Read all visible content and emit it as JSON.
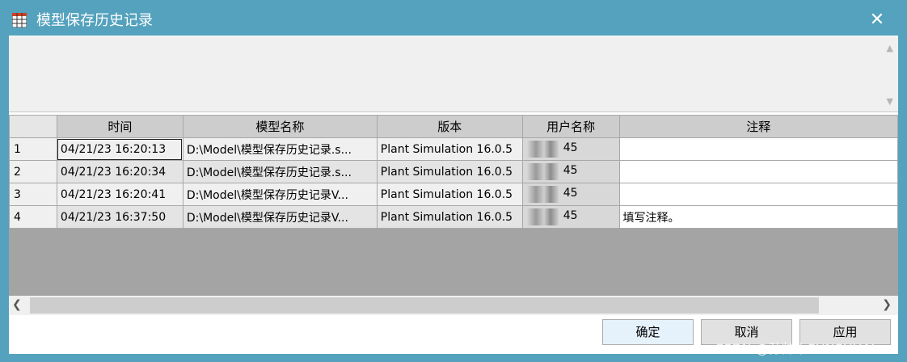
{
  "window": {
    "title": "模型保存历史记录",
    "close_glyph": "✕"
  },
  "grid": {
    "columns": [
      "时间",
      "模型名称",
      "版本",
      "用户名称",
      "注释"
    ],
    "rows": [
      {
        "index": "1",
        "time": "04/21/23 16:20:13",
        "model": "D:\\Model\\模型保存历史记录.s...",
        "version": "Plant Simulation 16.0.5",
        "user": "45",
        "note": ""
      },
      {
        "index": "2",
        "time": "04/21/23 16:20:34",
        "model": "D:\\Model\\模型保存历史记录.s...",
        "version": "Plant Simulation 16.0.5",
        "user": "45",
        "note": ""
      },
      {
        "index": "3",
        "time": "04/21/23 16:20:41",
        "model": "D:\\Model\\模型保存历史记录V...",
        "version": "Plant Simulation 16.0.5",
        "user": "45",
        "note": ""
      },
      {
        "index": "4",
        "time": "04/21/23 16:37:50",
        "model": "D:\\Model\\模型保存历史记录V...",
        "version": "Plant Simulation 16.0.5",
        "user": "45",
        "note": "填写注释。"
      }
    ]
  },
  "buttons": {
    "ok": "确定",
    "cancel": "取消",
    "apply": "应用"
  },
  "watermark": "CSDN @孙帅丨SUNSHUAI",
  "icons": {
    "app": "table-grid-icon",
    "close": "close-icon",
    "scroll_up": "arrow-up-icon",
    "scroll_down": "arrow-down-icon",
    "scroll_left": "arrow-left-icon",
    "scroll_right": "arrow-right-icon"
  }
}
